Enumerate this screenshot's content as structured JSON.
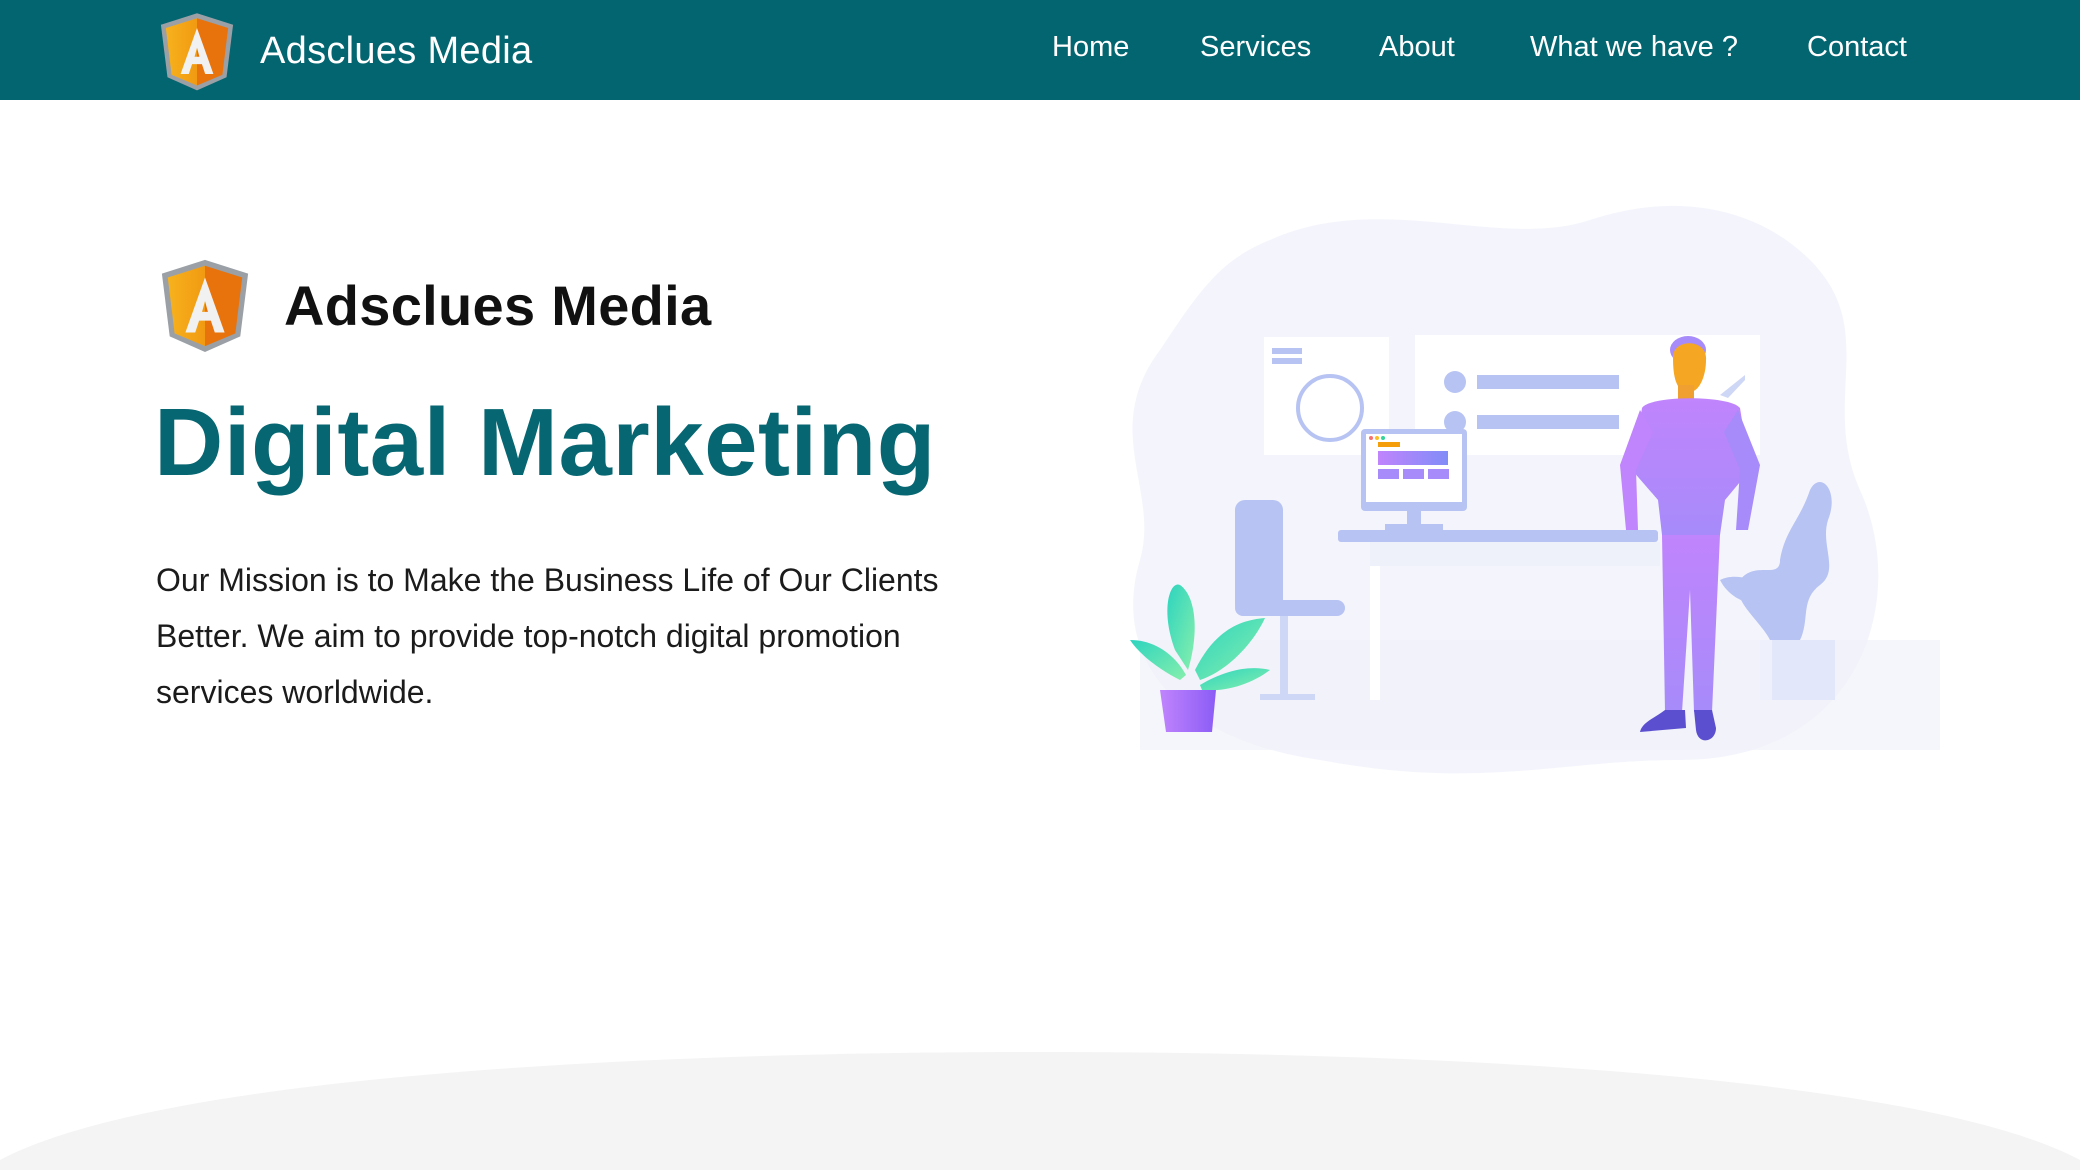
{
  "brand": {
    "name": "Adsclues Media",
    "logo_letter": "A",
    "logo_colors": {
      "left": "#f5a623",
      "right": "#e8730c",
      "rim": "#9aa0a6"
    }
  },
  "nav": {
    "background": "#036570",
    "items": [
      {
        "label": "Home"
      },
      {
        "label": "Services"
      },
      {
        "label": "About"
      },
      {
        "label": "What we have ?"
      },
      {
        "label": "Contact"
      }
    ]
  },
  "hero": {
    "brand_name": "Adsclues Media",
    "title": "Digital Marketing",
    "title_color": "#066671",
    "mission": "Our Mission is to Make the Business Life of Our Clients Better. We aim to provide top-notch digital promotion services worldwide."
  },
  "illustration": {
    "icon": "office-person-illustration",
    "accent_colors": [
      "#a78bfa",
      "#c4b5fd",
      "#b7c3f2",
      "#f5a623",
      "#34d399"
    ]
  }
}
